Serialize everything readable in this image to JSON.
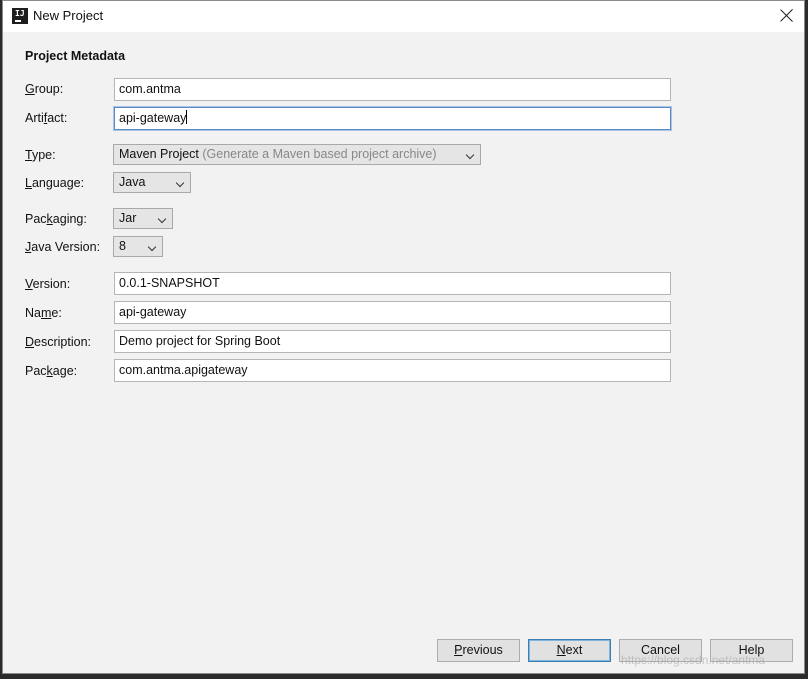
{
  "window": {
    "title": "New Project"
  },
  "section": {
    "title": "Project Metadata"
  },
  "fields": {
    "group": {
      "label": "Group:",
      "mn": "G",
      "rest": "roup:",
      "value": "com.antma"
    },
    "artifact": {
      "label": "Artifact:",
      "mn_pre": "Arti",
      "mn": "f",
      "rest": "act:",
      "value": "api-gateway"
    },
    "type": {
      "label": "Type:",
      "mn": "T",
      "rest": "ype:",
      "value": "Maven Project",
      "hint": "(Generate a Maven based project archive)"
    },
    "language": {
      "label": "Language:",
      "mn": "L",
      "rest": "anguage:",
      "value": "Java"
    },
    "packaging": {
      "label": "Packaging:",
      "mn_pre": "Pac",
      "mn": "k",
      "rest": "aging:",
      "value": "Jar"
    },
    "java_version": {
      "label": "Java Version:",
      "mn": "J",
      "rest": "ava Version:",
      "value": "8"
    },
    "version": {
      "label": "Version:",
      "mn": "V",
      "rest": "ersion:",
      "value": "0.0.1-SNAPSHOT"
    },
    "name": {
      "label": "Name:",
      "mn_pre": "Na",
      "mn": "m",
      "rest": "e:",
      "value": "api-gateway"
    },
    "description": {
      "label": "Description:",
      "mn": "D",
      "rest": "escription:",
      "value": "Demo project for Spring Boot"
    },
    "package": {
      "label": "Package:",
      "mn_pre": "Pac",
      "mn": "k",
      "rest": "age:",
      "value": "com.antma.apigateway"
    }
  },
  "buttons": {
    "previous": {
      "mn": "P",
      "rest": "revious"
    },
    "next": {
      "mn": "N",
      "rest": "ext"
    },
    "cancel": "Cancel",
    "help": "Help"
  },
  "watermark": "https://blog.csdn.net/antma",
  "icons": {
    "app": "intellij-idea-icon",
    "close": "close-icon",
    "dropdown": "chevron-down-icon"
  }
}
